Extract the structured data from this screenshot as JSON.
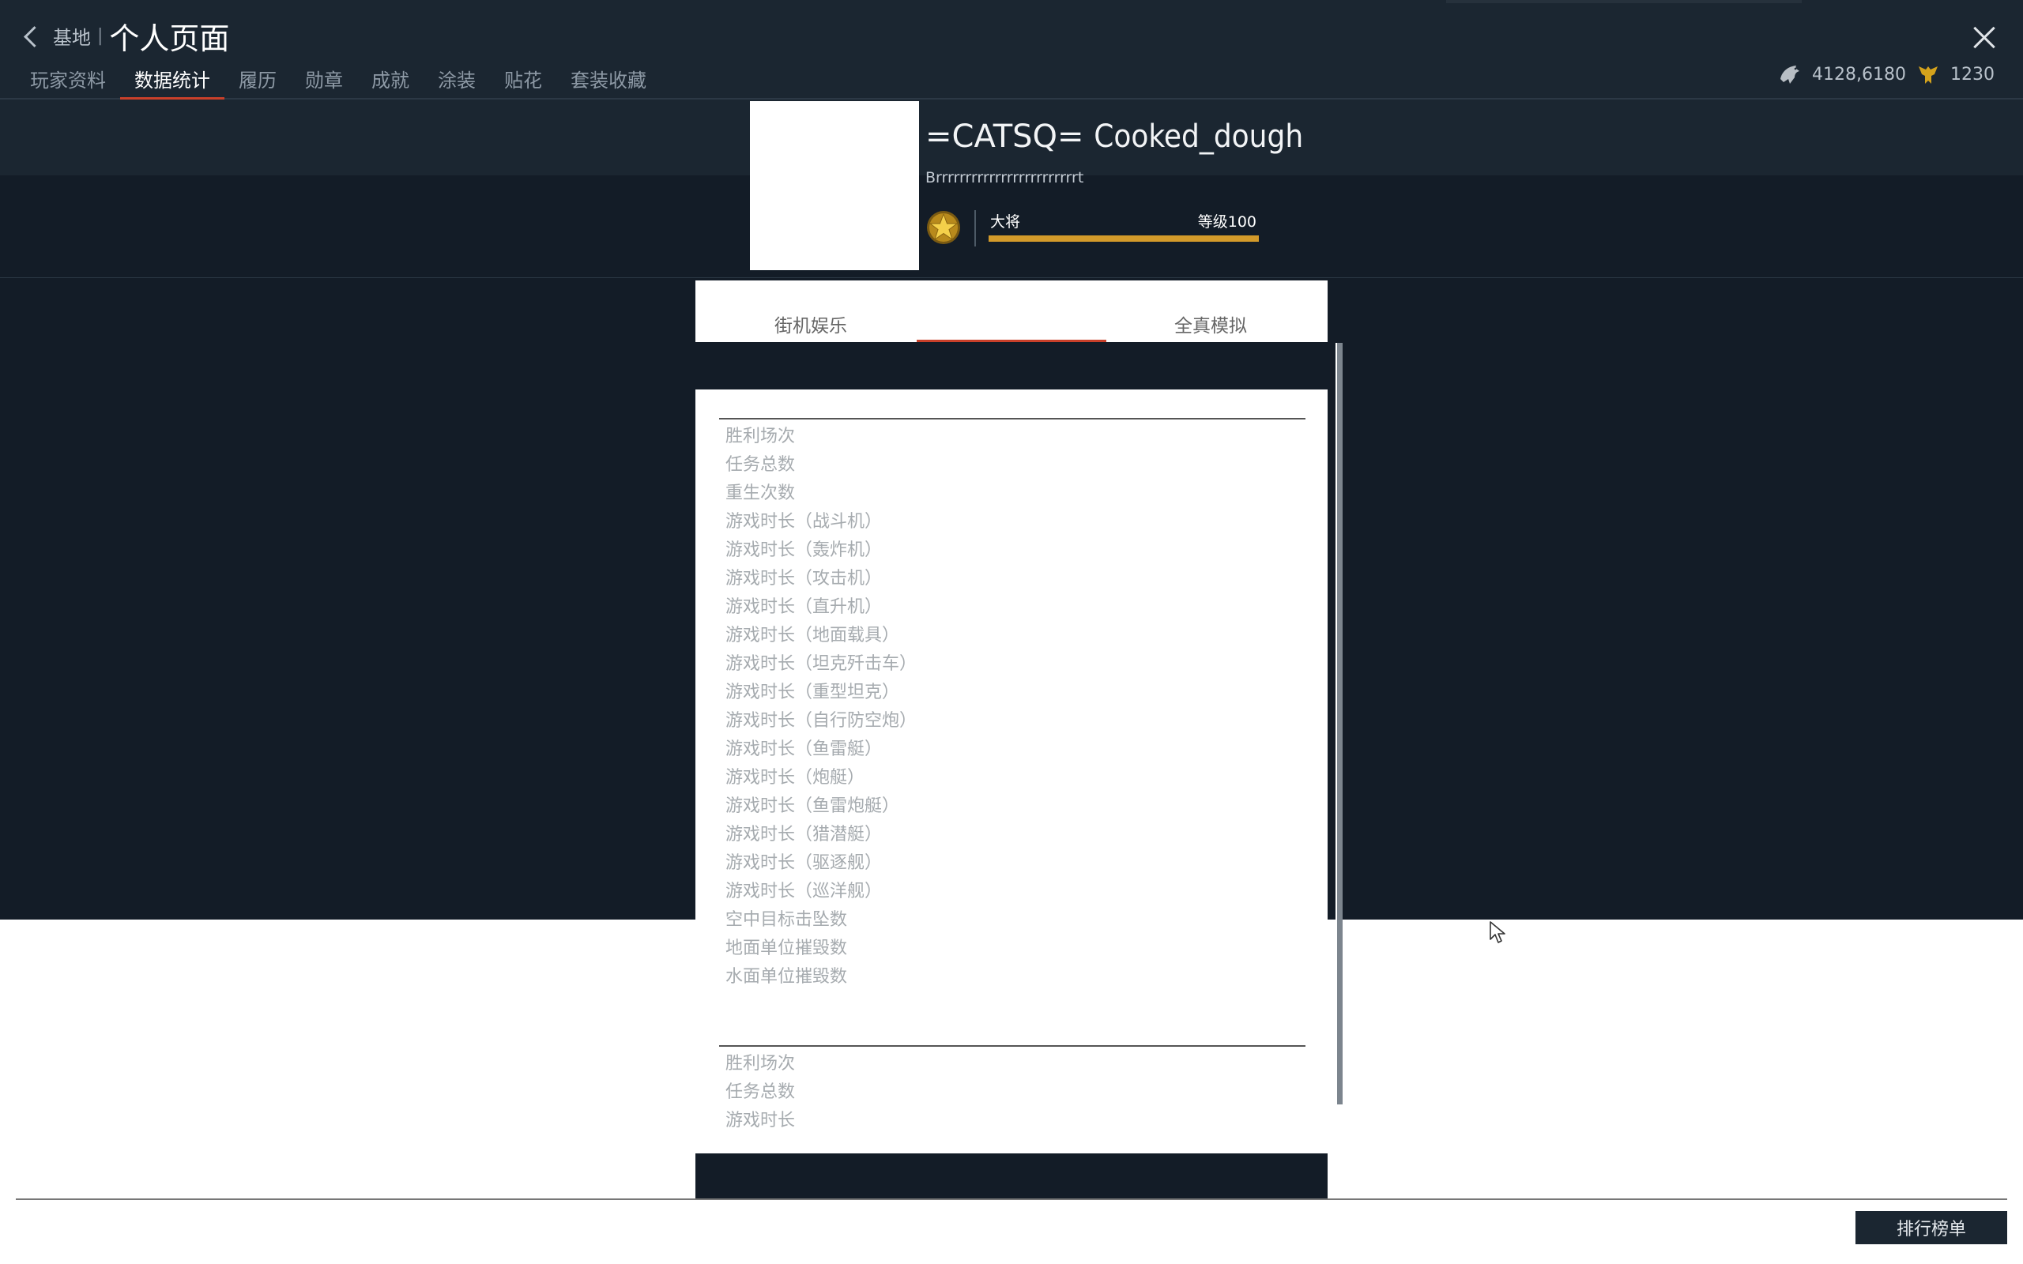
{
  "header": {
    "back_label": "基地",
    "separator": "|",
    "title": "个人页面",
    "close_icon": "close-icon"
  },
  "nav": {
    "items": [
      {
        "label": "玩家资料"
      },
      {
        "label": "数据统计",
        "active": true
      },
      {
        "label": "履历"
      },
      {
        "label": "勋章"
      },
      {
        "label": "成就"
      },
      {
        "label": "涂装"
      },
      {
        "label": "贴花"
      },
      {
        "label": "套装收藏"
      }
    ]
  },
  "currency": {
    "silver": "4128,6180",
    "gold": "1230",
    "silver_icon": "eagle-silver-icon",
    "gold_icon": "eagle-gold-icon"
  },
  "profile": {
    "clan_tag": "=CATSQ=",
    "name": "Cooked_dough",
    "motto": "Brrrrrrrrrrrrrrrrrrrrrrrrt",
    "rank": "大将",
    "level": "等级100",
    "level_progress": 1.0,
    "rank_icon": "star-rank-icon"
  },
  "modes": {
    "arcade": "街机娱乐",
    "selected_center": "",
    "realistic": "全真模拟"
  },
  "stats": {
    "section_a": [
      "胜利场次",
      "任务总数",
      "重生次数",
      "游戏时长（战斗机）",
      "游戏时长（轰炸机）",
      "游戏时长（攻击机）",
      "游戏时长（直升机）",
      "游戏时长（地面载具）",
      "游戏时长（坦克歼击车）",
      "游戏时长（重型坦克）",
      "游戏时长（自行防空炮）",
      "游戏时长（鱼雷艇）",
      "游戏时长（炮艇）",
      "游戏时长（鱼雷炮艇）",
      "游戏时长（猎潜艇）",
      "游戏时长（驱逐舰）",
      "游戏时长（巡洋舰）",
      "空中目标击坠数",
      "地面单位摧毁数",
      "水面单位摧毁数"
    ],
    "section_b": [
      "胜利场次",
      "任务总数",
      "游戏时长"
    ]
  },
  "footer": {
    "leaderboard_label": "排行榜单"
  },
  "colors": {
    "accent": "#c9402a",
    "level_bar": "#d39a2a",
    "background": "#131c27",
    "header_band": "#1b2631"
  }
}
